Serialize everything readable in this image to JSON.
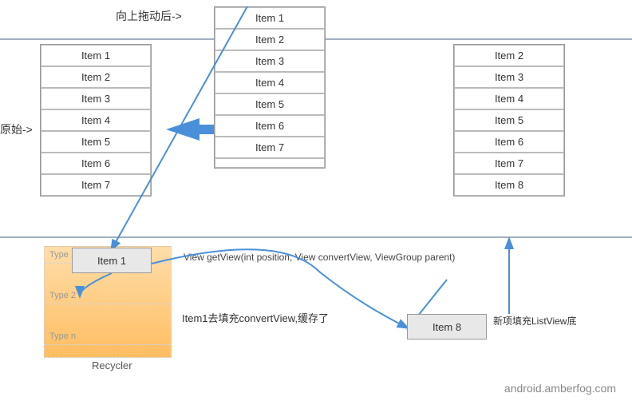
{
  "labels": {
    "yuanshi": "原始->",
    "xiangshang": "向上拖动后->",
    "recycler": "Recycler",
    "watermark": "android.amberfog.com",
    "getview": "View getView(int position, View convertView, ViewGroup parent)",
    "item1fills": "Item1去填充convertView,缓存了",
    "newitem": "新项填充ListView底"
  },
  "list_original": {
    "items": [
      "Item 1",
      "Item 2",
      "Item 3",
      "Item 4",
      "Item 5",
      "Item 6",
      "Item 7"
    ]
  },
  "list_middle": {
    "items": [
      "Item 1",
      "Item 2",
      "Item 3",
      "Item 4",
      "Item 5",
      "Item 6",
      "Item 7",
      ""
    ]
  },
  "list_right": {
    "items": [
      "Item 2",
      "Item 3",
      "Item 4",
      "Item 5",
      "Item 6",
      "Item 7",
      "Item 8"
    ]
  },
  "recycler_types": [
    "Type 1",
    "Type 2",
    "Type n"
  ],
  "item1_label": "Item 1",
  "item8_label": "Item 8"
}
